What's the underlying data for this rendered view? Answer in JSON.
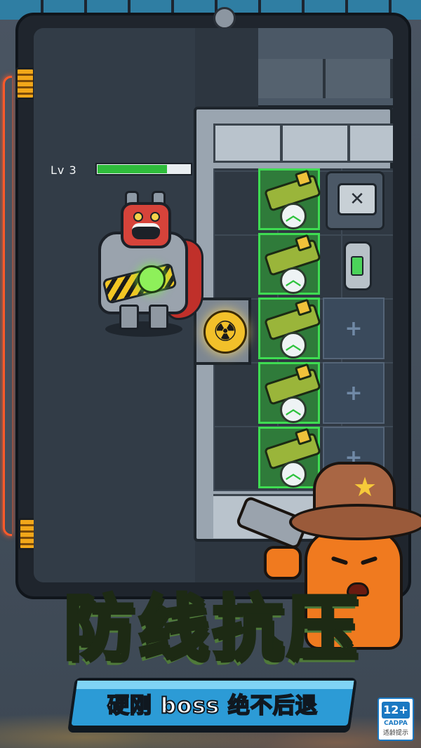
{
  "game": {
    "title_chars": [
      "防",
      "线",
      "抗",
      "压"
    ],
    "subtitle": "硬刚 boss 绝不后退"
  },
  "boss": {
    "level_label": "Lv 3",
    "health_fraction": 0.75,
    "health_color": "#2fbc3b"
  },
  "grid": {
    "weapon_slots": [
      {
        "icon": "gun-icon",
        "upgrade_icon": "upgrade-arrow-icon",
        "upgrade_glyph": "︿"
      },
      {
        "icon": "gun-icon",
        "upgrade_icon": "upgrade-arrow-icon",
        "upgrade_glyph": "︿"
      },
      {
        "icon": "gun-icon",
        "upgrade_icon": "upgrade-arrow-icon",
        "upgrade_glyph": "︿"
      },
      {
        "icon": "gun-icon",
        "upgrade_icon": "upgrade-arrow-icon",
        "upgrade_glyph": "︿"
      },
      {
        "icon": "gun-icon",
        "upgrade_icon": "upgrade-arrow-icon",
        "upgrade_glyph": "︿"
      }
    ],
    "empty_slot_glyph": "+",
    "toolbox_glyph": "✕",
    "reactor_glyph": "☢"
  },
  "rating": {
    "age": "12+",
    "org": "CADPA",
    "tip": "适龄提示"
  },
  "colors": {
    "slot_border": "#3fdc52",
    "slot_fill": "#2f7b3a",
    "hazard": "#f3c623",
    "banner": "#2c9bd6",
    "title_fill": "#e6f2c8"
  }
}
